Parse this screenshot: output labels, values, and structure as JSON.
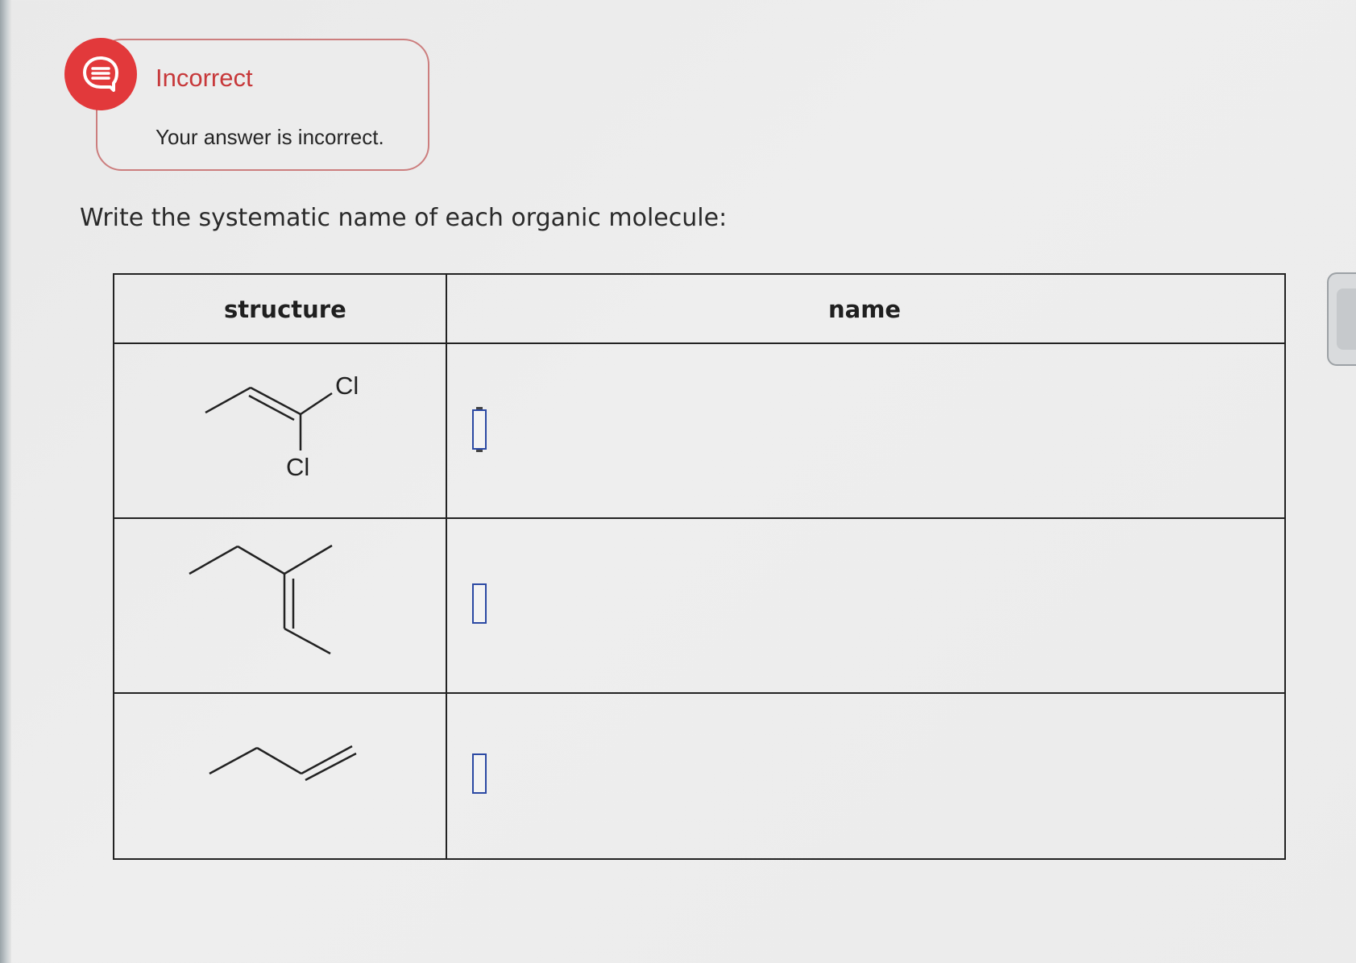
{
  "feedback": {
    "status": "Incorrect",
    "message": "Your answer is incorrect.",
    "icon": "chat-bubble-icon",
    "accent_color": "#e2393b"
  },
  "question": {
    "prompt": "Write the systematic name of each organic molecule:"
  },
  "table": {
    "headers": {
      "structure": "structure",
      "name": "name"
    },
    "rows": [
      {
        "structure_labels": [
          "Cl",
          "Cl"
        ],
        "answer_value": ""
      },
      {
        "structure_labels": [],
        "answer_value": ""
      },
      {
        "structure_labels": [],
        "answer_value": ""
      }
    ]
  },
  "colors": {
    "border": "#222222",
    "answer_box_border": "#2b49a3",
    "incorrect_text": "#c7383a"
  }
}
